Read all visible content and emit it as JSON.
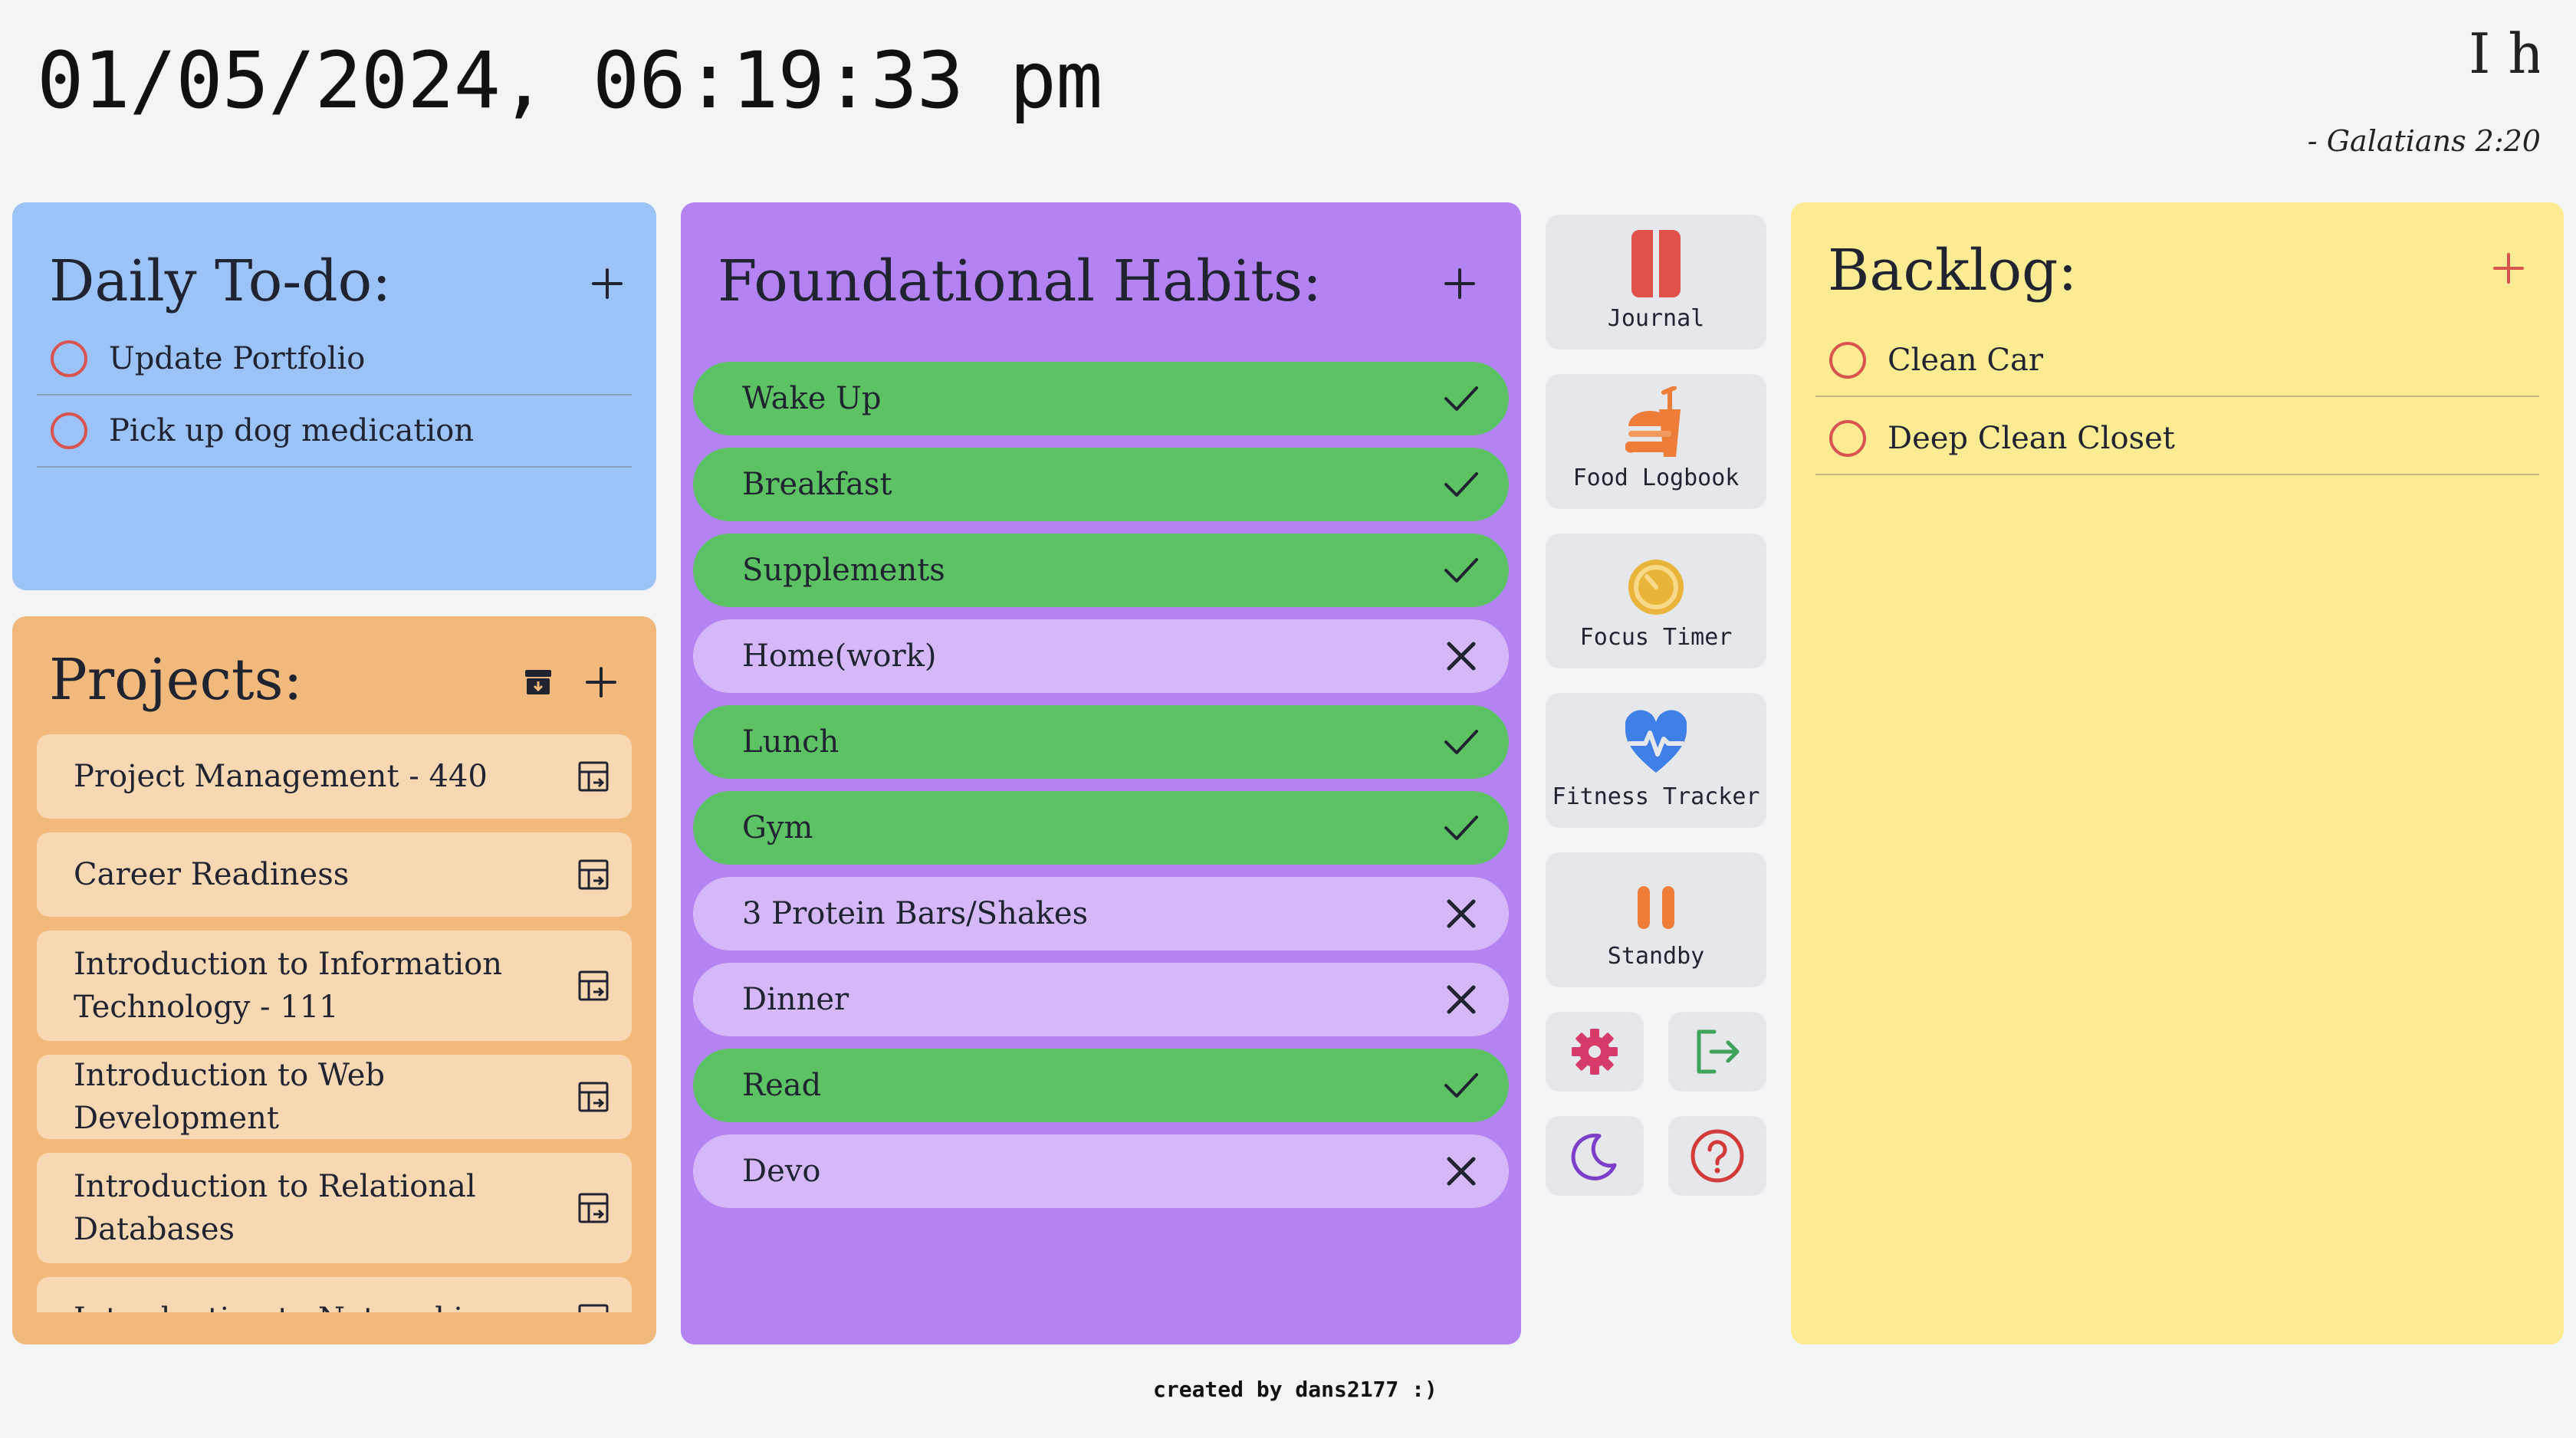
{
  "header": {
    "datetime": "01/05/2024, 06:19:33 pm",
    "verse_visible": "I h",
    "verse_reference": "- Galatians 2:20"
  },
  "todo": {
    "title": "Daily To-do:",
    "items": [
      {
        "label": "Update Portfolio",
        "done": false
      },
      {
        "label": "Pick up dog medication",
        "done": false
      }
    ]
  },
  "projects": {
    "title": "Projects:",
    "items": [
      {
        "label": "Project Management - 440"
      },
      {
        "label": "Career Readiness"
      },
      {
        "label": "Introduction to Information Technology - 111"
      },
      {
        "label": "Introduction to Web Development"
      },
      {
        "label": "Introduction to Relational Databases"
      },
      {
        "label": "Introduction to Networking"
      }
    ]
  },
  "habits": {
    "title": "Foundational Habits:",
    "items": [
      {
        "label": "Wake Up",
        "done": true
      },
      {
        "label": "Breakfast",
        "done": true
      },
      {
        "label": "Supplements",
        "done": true
      },
      {
        "label": "Home(work)",
        "done": false
      },
      {
        "label": "Lunch",
        "done": true
      },
      {
        "label": "Gym",
        "done": true
      },
      {
        "label": "3 Protein Bars/Shakes",
        "done": false
      },
      {
        "label": "Dinner",
        "done": false
      },
      {
        "label": "Read",
        "done": true
      },
      {
        "label": "Devo",
        "done": false
      }
    ]
  },
  "sidebar": {
    "tiles": [
      {
        "label": "Journal",
        "icon": "journal-icon",
        "color": "#e0514b"
      },
      {
        "label": "Food Logbook",
        "icon": "burger-icon",
        "color": "#ef7d3a"
      },
      {
        "label": "Focus Timer",
        "icon": "timer-icon",
        "color": "#e8b43a"
      },
      {
        "label": "Fitness Tracker",
        "icon": "heart-pulse-icon",
        "color": "#3f7fe8"
      },
      {
        "label": "Standby",
        "icon": "pause-icon",
        "color": "#ef7d3a"
      }
    ],
    "buttons": [
      {
        "icon": "gear-icon",
        "color": "#d63b6a"
      },
      {
        "icon": "logout-icon",
        "color": "#3fa35a"
      },
      {
        "icon": "moon-icon",
        "color": "#7b3fc9"
      },
      {
        "icon": "help-icon",
        "color": "#d33a3a"
      }
    ]
  },
  "backlog": {
    "title": "Backlog:",
    "items": [
      {
        "label": "Clean Car",
        "done": false
      },
      {
        "label": "Deep Clean Closet",
        "done": false
      }
    ]
  },
  "footer": {
    "text": "created by dans2177 :)"
  },
  "colors": {
    "todo_panel": "#9cc3f7",
    "projects_panel": "#f2b97c",
    "habits_panel": "#b483f3",
    "backlog_panel": "#fbec94",
    "habit_done": "#5dc264",
    "habit_pending": "#d4b8f8"
  }
}
